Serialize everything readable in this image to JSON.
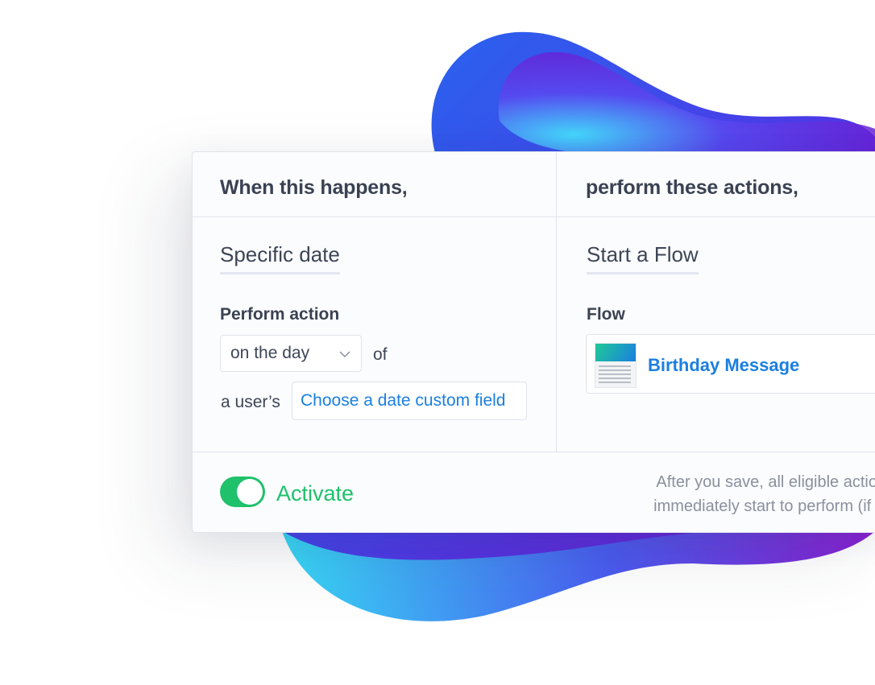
{
  "header": {
    "trigger_title": "When this happens,",
    "action_title": "perform these actions,"
  },
  "trigger": {
    "type_label": "Specific date",
    "perform_action_label": "Perform action",
    "timing_select_value": "on the day",
    "of_text": "of",
    "user_prefix": "a user’s",
    "custom_field_placeholder": "Choose a date custom field"
  },
  "action": {
    "type_label": "Start a Flow",
    "flow_label": "Flow",
    "flow_name": "Birthday Message"
  },
  "footer": {
    "activate_label": "Activate",
    "activate_on": true,
    "note_line1": "After you save, all eligible actions wil",
    "note_line2": "immediately start to perform (if activa"
  },
  "colors": {
    "accent_blue": "#1a7fe0",
    "toggle_green": "#1fc16b",
    "text_dark": "#3a4252",
    "muted": "#8a909c"
  }
}
